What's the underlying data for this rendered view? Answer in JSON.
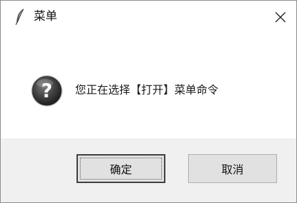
{
  "window": {
    "title": "菜单"
  },
  "titlebar": {
    "app_icon": "feather-icon",
    "close_icon": "close-icon"
  },
  "dialog": {
    "icon": "question-icon",
    "message": "您正在选择【打开】菜单命令"
  },
  "buttons": {
    "ok_label": "确定",
    "cancel_label": "取消"
  },
  "colors": {
    "footer_bg": "#f0f0f0",
    "button_bg": "#e1e1e1",
    "icon_dark": "#3a3a3a"
  }
}
